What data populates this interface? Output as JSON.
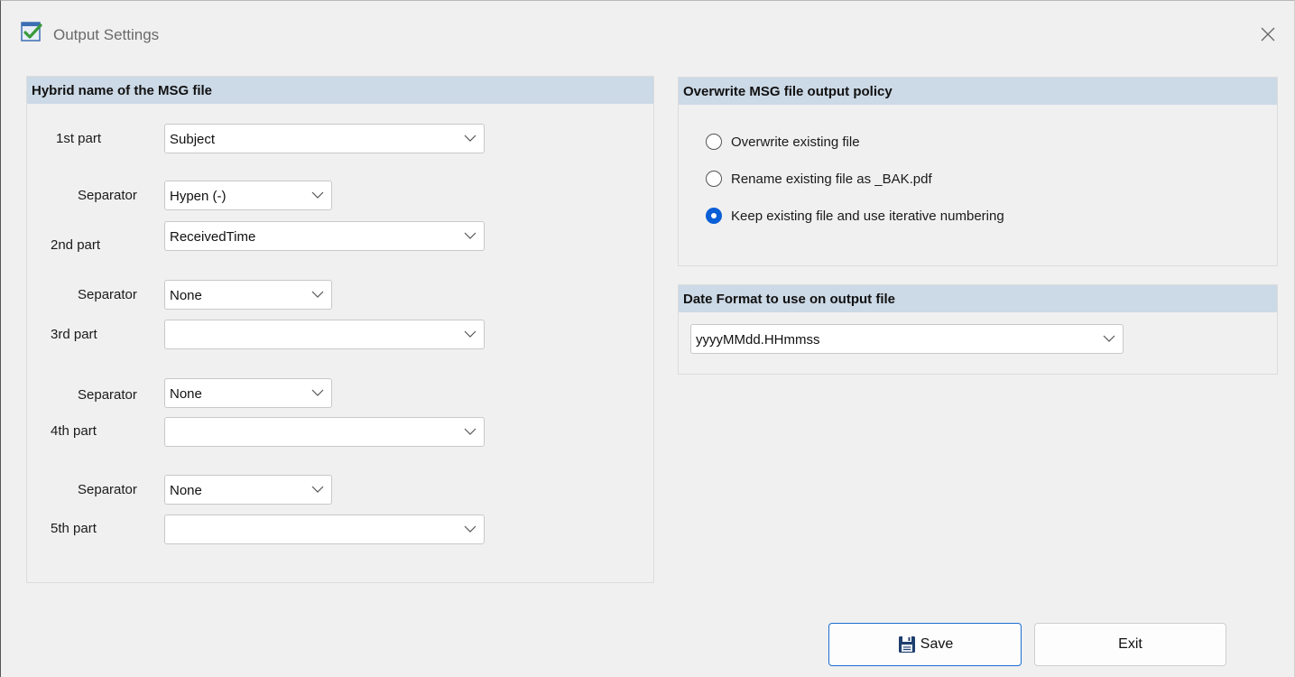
{
  "window": {
    "title": "Output Settings"
  },
  "hybrid": {
    "header": "Hybrid name of the MSG file",
    "parts": [
      {
        "label": "1st part",
        "value": "Subject"
      },
      {
        "label": "2nd part",
        "value": "ReceivedTime"
      },
      {
        "label": "3rd part",
        "value": ""
      },
      {
        "label": "4th part",
        "value": ""
      },
      {
        "label": "5th part",
        "value": ""
      }
    ],
    "separators": [
      {
        "label": "Separator",
        "value": "Hypen (-)"
      },
      {
        "label": "Separator",
        "value": "None"
      },
      {
        "label": "Separator",
        "value": "None"
      },
      {
        "label": "Separator",
        "value": "None"
      }
    ]
  },
  "overwrite": {
    "header": "Overwrite MSG file output policy",
    "options": [
      {
        "label": "Overwrite existing file",
        "checked": false
      },
      {
        "label": "Rename existing file as _BAK.pdf",
        "checked": false
      },
      {
        "label": "Keep existing file and use iterative numbering",
        "checked": true
      }
    ]
  },
  "date_format": {
    "header": "Date Format to use on output file",
    "value": "yyyyMMdd.HHmmss"
  },
  "buttons": {
    "save": "Save",
    "exit": "Exit"
  },
  "colors": {
    "accent": "#1b6ed4",
    "radio_checked": "#0a5fd6",
    "group_header": "#ccd9e6"
  },
  "icons": {
    "app": "checklist-app-icon",
    "close": "close-icon",
    "save": "floppy-disk-icon",
    "dropdown": "chevron-down-icon"
  }
}
